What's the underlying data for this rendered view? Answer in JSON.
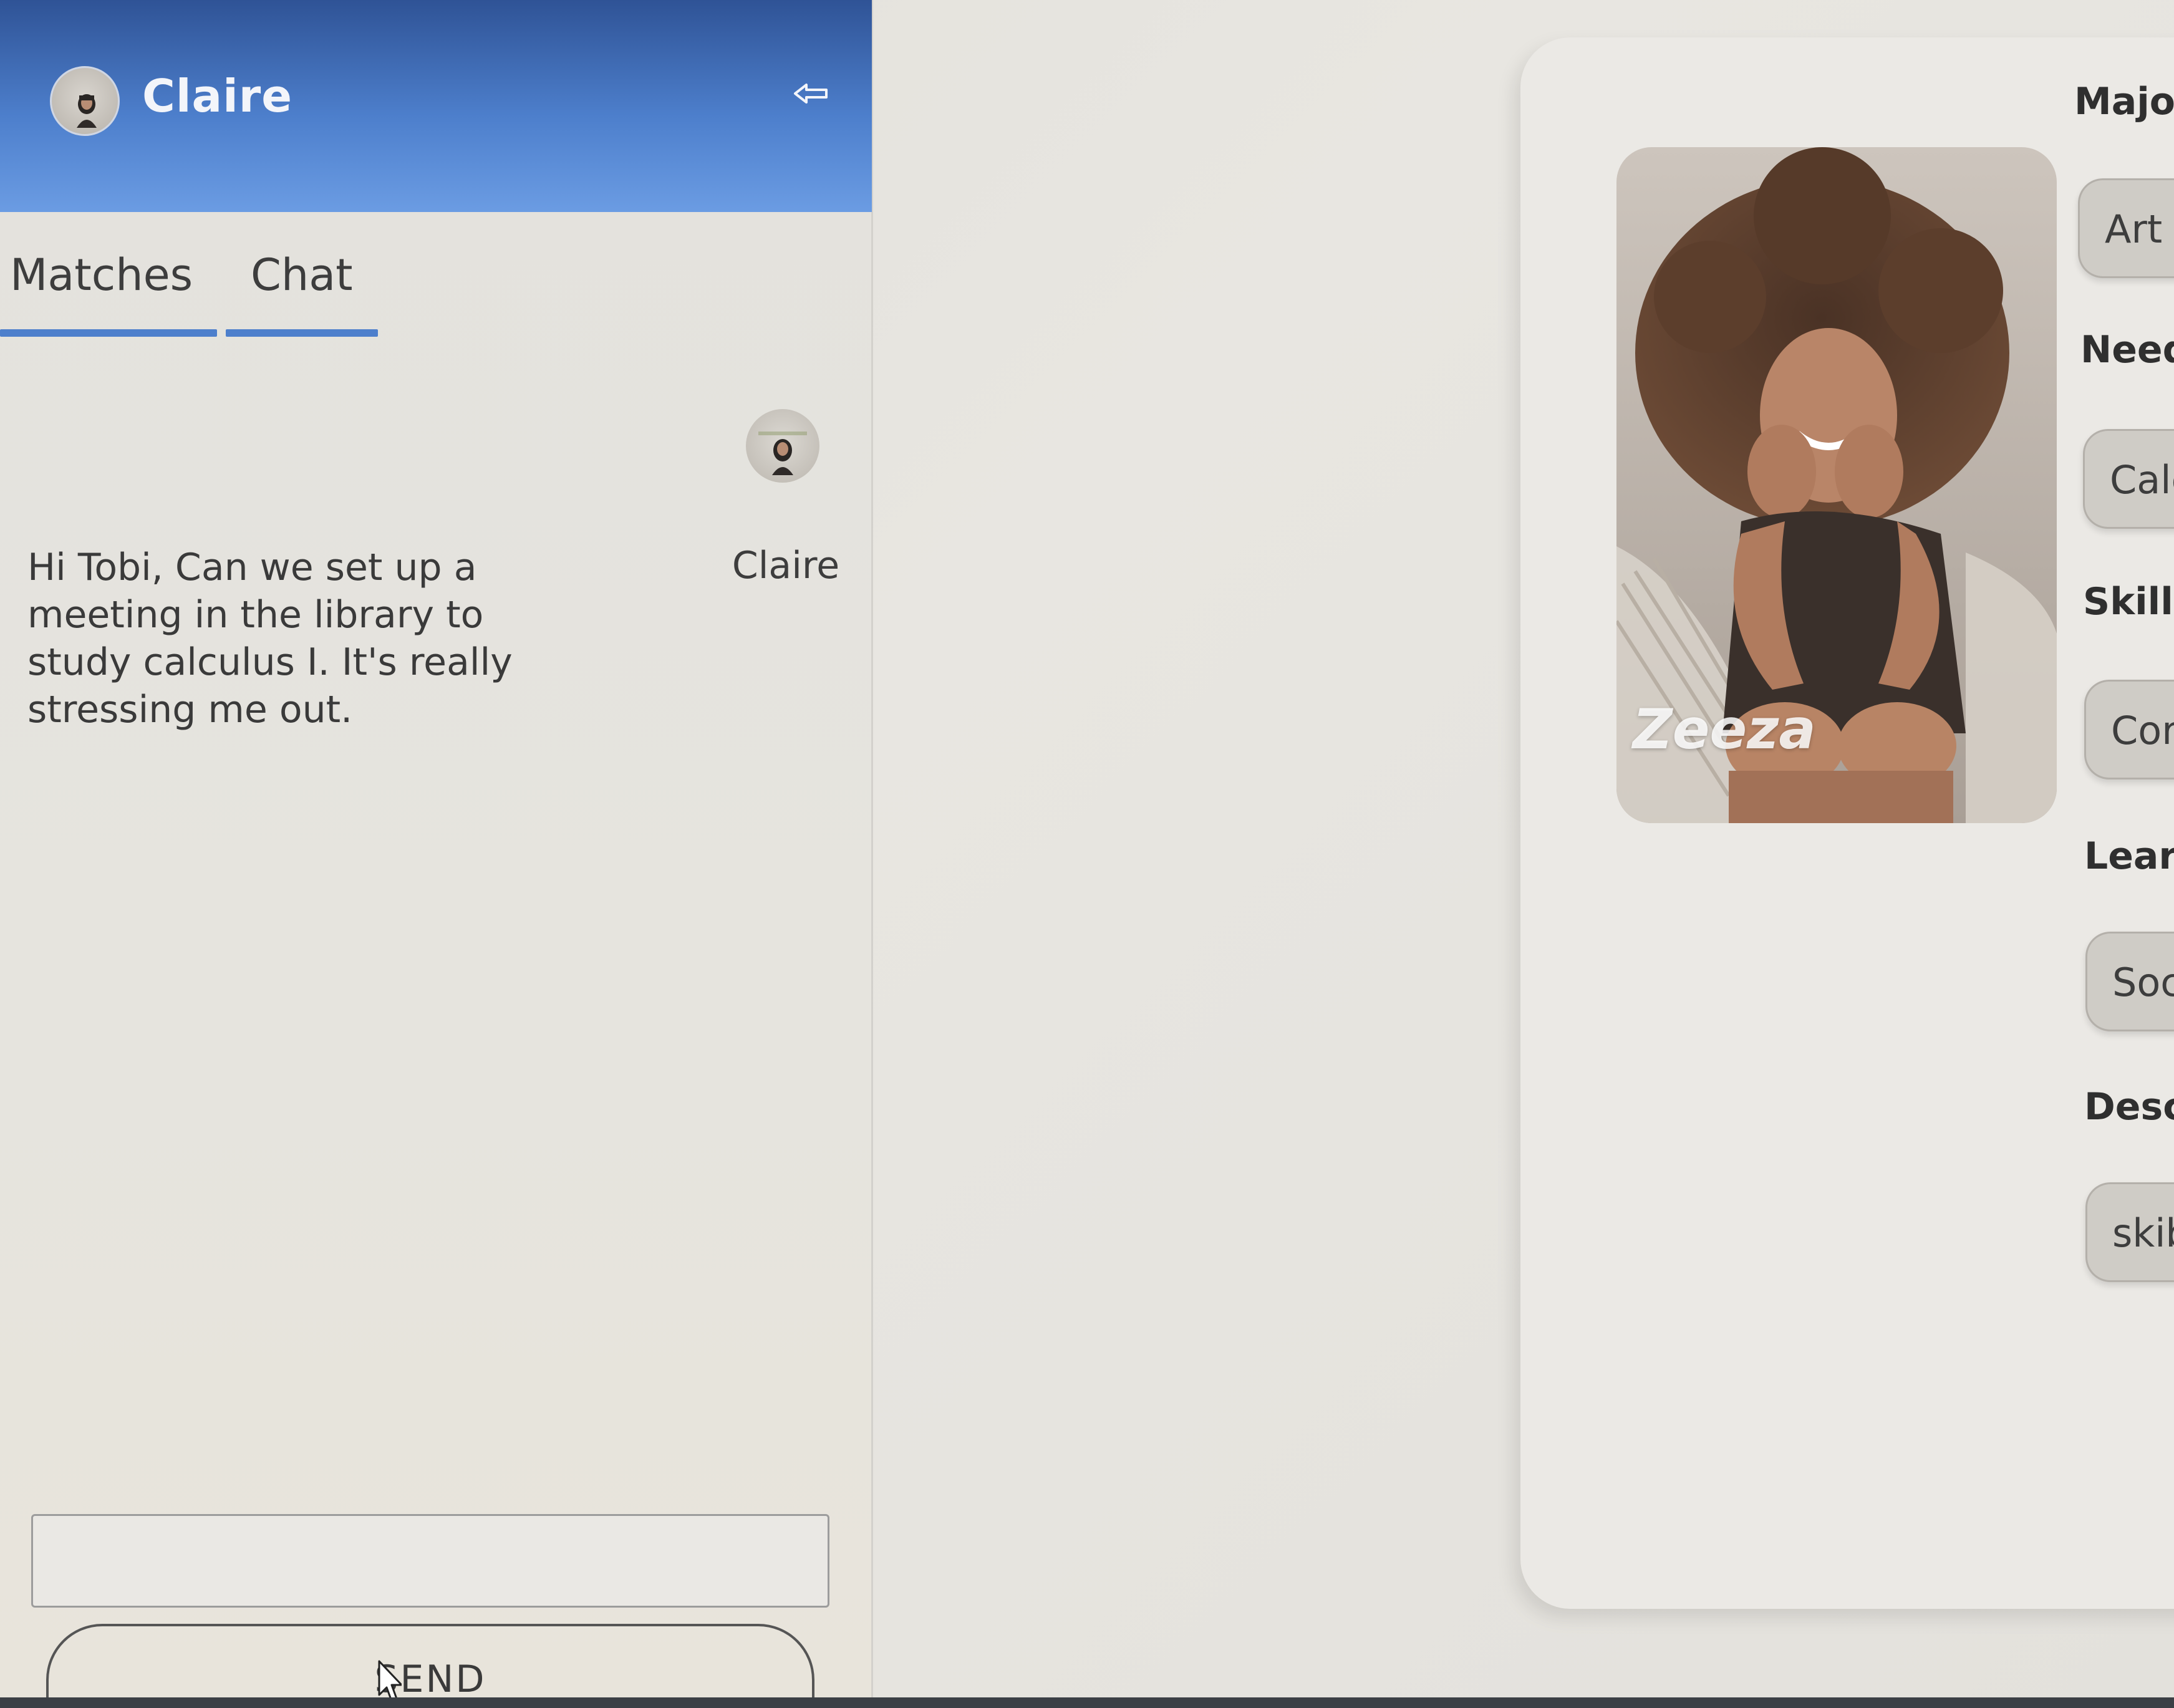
{
  "header": {
    "name": "Claire",
    "back_icon": "back-arrow-icon"
  },
  "tabs": [
    {
      "label": "Matches",
      "active": true
    },
    {
      "label": "Chat",
      "active": true
    }
  ],
  "message": {
    "sender": "Claire",
    "text": "Hi Tobi, Can we set up a meeting in the library to study calculus I. It's really stressing me out."
  },
  "composer": {
    "input_value": "",
    "send_label": "SEND"
  },
  "profile": {
    "name": "Zeeza",
    "fields": [
      {
        "label": "Major",
        "value": "Art"
      },
      {
        "label": "Need",
        "value": "Calc"
      },
      {
        "label": "Skill",
        "value": "Cor"
      },
      {
        "label": "Lear",
        "value": "Soc"
      },
      {
        "label": "Desc",
        "value": "skib"
      }
    ]
  },
  "colors": {
    "header_top": "#2f5396",
    "header_bottom": "#6b9ce3",
    "tab_underline": "#4d7fcc"
  }
}
